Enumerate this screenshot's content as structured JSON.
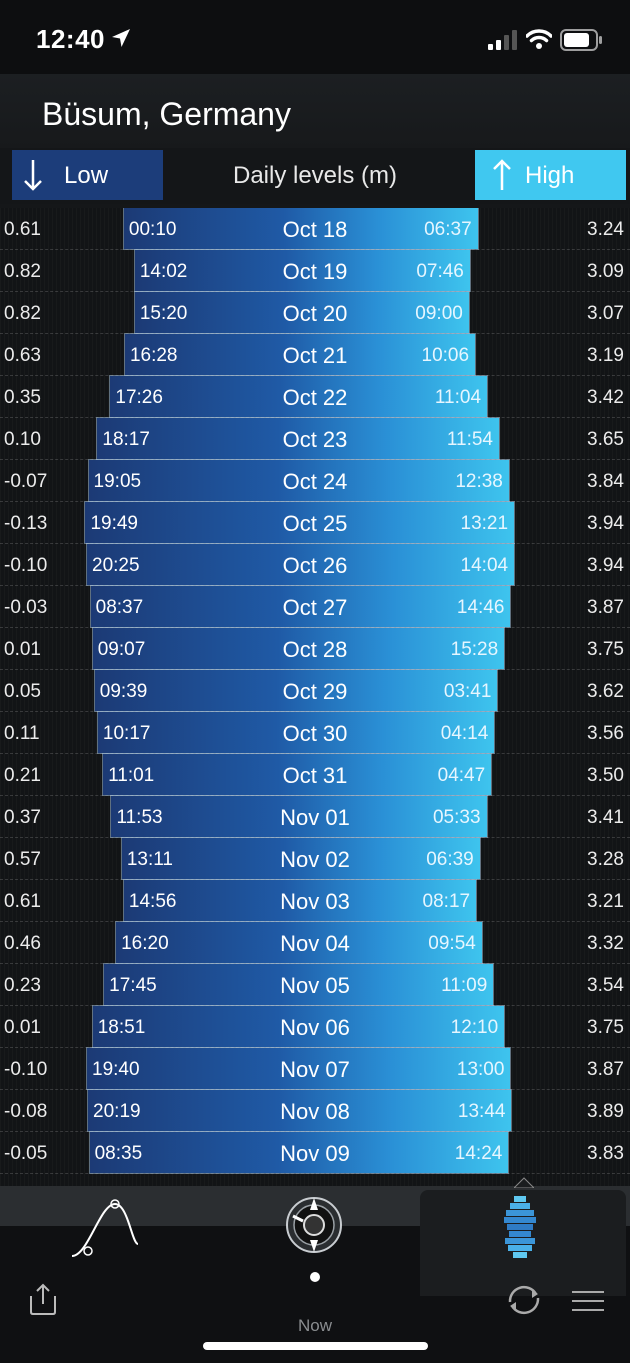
{
  "status": {
    "time": "12:40"
  },
  "header": {
    "location": "Büsum, Germany"
  },
  "legend": {
    "low_label": "Low",
    "title": "Daily levels (m)",
    "high_label": "High"
  },
  "rows": [
    {
      "date": "Oct 18",
      "low_time": "00:10",
      "high_time": "06:37",
      "low": "0.61",
      "high": "3.24"
    },
    {
      "date": "Oct 19",
      "low_time": "14:02",
      "high_time": "07:46",
      "low": "0.82",
      "high": "3.09"
    },
    {
      "date": "Oct 20",
      "low_time": "15:20",
      "high_time": "09:00",
      "low": "0.82",
      "high": "3.07"
    },
    {
      "date": "Oct 21",
      "low_time": "16:28",
      "high_time": "10:06",
      "low": "0.63",
      "high": "3.19"
    },
    {
      "date": "Oct 22",
      "low_time": "17:26",
      "high_time": "11:04",
      "low": "0.35",
      "high": "3.42"
    },
    {
      "date": "Oct 23",
      "low_time": "18:17",
      "high_time": "11:54",
      "low": "0.10",
      "high": "3.65"
    },
    {
      "date": "Oct 24",
      "low_time": "19:05",
      "high_time": "12:38",
      "low": "-0.07",
      "high": "3.84"
    },
    {
      "date": "Oct 25",
      "low_time": "19:49",
      "high_time": "13:21",
      "low": "-0.13",
      "high": "3.94"
    },
    {
      "date": "Oct 26",
      "low_time": "20:25",
      "high_time": "14:04",
      "low": "-0.10",
      "high": "3.94"
    },
    {
      "date": "Oct 27",
      "low_time": "08:37",
      "high_time": "14:46",
      "low": "-0.03",
      "high": "3.87"
    },
    {
      "date": "Oct 28",
      "low_time": "09:07",
      "high_time": "15:28",
      "low": "0.01",
      "high": "3.75"
    },
    {
      "date": "Oct 29",
      "low_time": "09:39",
      "high_time": "03:41",
      "low": "0.05",
      "high": "3.62"
    },
    {
      "date": "Oct 30",
      "low_time": "10:17",
      "high_time": "04:14",
      "low": "0.11",
      "high": "3.56"
    },
    {
      "date": "Oct 31",
      "low_time": "11:01",
      "high_time": "04:47",
      "low": "0.21",
      "high": "3.50"
    },
    {
      "date": "Nov 01",
      "low_time": "11:53",
      "high_time": "05:33",
      "low": "0.37",
      "high": "3.41"
    },
    {
      "date": "Nov 02",
      "low_time": "13:11",
      "high_time": "06:39",
      "low": "0.57",
      "high": "3.28"
    },
    {
      "date": "Nov 03",
      "low_time": "14:56",
      "high_time": "08:17",
      "low": "0.61",
      "high": "3.21"
    },
    {
      "date": "Nov 04",
      "low_time": "16:20",
      "high_time": "09:54",
      "low": "0.46",
      "high": "3.32"
    },
    {
      "date": "Nov 05",
      "low_time": "17:45",
      "high_time": "11:09",
      "low": "0.23",
      "high": "3.54"
    },
    {
      "date": "Nov 06",
      "low_time": "18:51",
      "high_time": "12:10",
      "low": "0.01",
      "high": "3.75"
    },
    {
      "date": "Nov 07",
      "low_time": "19:40",
      "high_time": "13:00",
      "low": "-0.10",
      "high": "3.87"
    },
    {
      "date": "Nov 08",
      "low_time": "20:19",
      "high_time": "13:44",
      "low": "-0.08",
      "high": "3.89"
    },
    {
      "date": "Nov 09",
      "low_time": "08:35",
      "high_time": "14:24",
      "low": "-0.05",
      "high": "3.83"
    }
  ],
  "tabbar": {
    "tabs": [
      {
        "icon": "tide-curve-icon"
      },
      {
        "icon": "compass-icon"
      },
      {
        "icon": "daily-levels-icon"
      }
    ],
    "now_label": "Now"
  },
  "colors": {
    "low": "#1c3d7a",
    "high": "#40c8f0",
    "background": "#151719"
  }
}
